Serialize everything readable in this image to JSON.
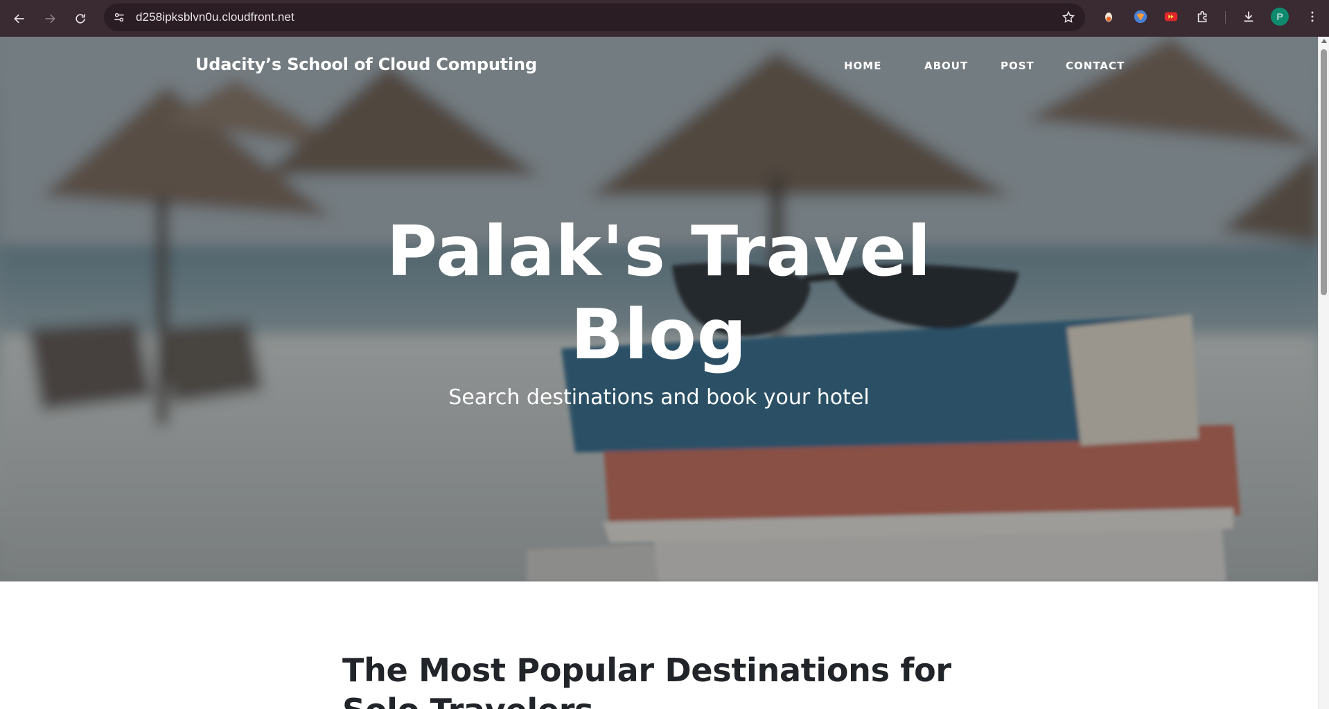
{
  "browser": {
    "url": "d258ipksblvn0u.cloudfront.net",
    "profile_initial": "P",
    "icons": {
      "back": "back-arrow-icon",
      "forward": "forward-arrow-icon",
      "reload": "reload-icon",
      "site_info": "site-settings-icon",
      "bookmark": "star-icon",
      "extension_1": "extension-icon",
      "extension_2": "extension-icon",
      "extension_3": "extension-icon",
      "extensions_menu": "puzzle-icon",
      "downloads": "download-icon",
      "menu": "kebab-menu-icon"
    },
    "colors": {
      "toolbar": "#3a2a31",
      "omnibox": "#2a1d23",
      "profile": "#0f8a6e"
    }
  },
  "site": {
    "brand": "Udacity’s School of Cloud Computing",
    "nav": [
      {
        "label": "HOME"
      },
      {
        "label": "ABOUT"
      },
      {
        "label": "POST"
      },
      {
        "label": "CONTACT"
      }
    ]
  },
  "hero": {
    "title": "Palak's Travel Blog",
    "subtitle": "Search destinations and book your hotel"
  },
  "main": {
    "post_title": "The Most Popular Destinations for Solo Travelers"
  }
}
